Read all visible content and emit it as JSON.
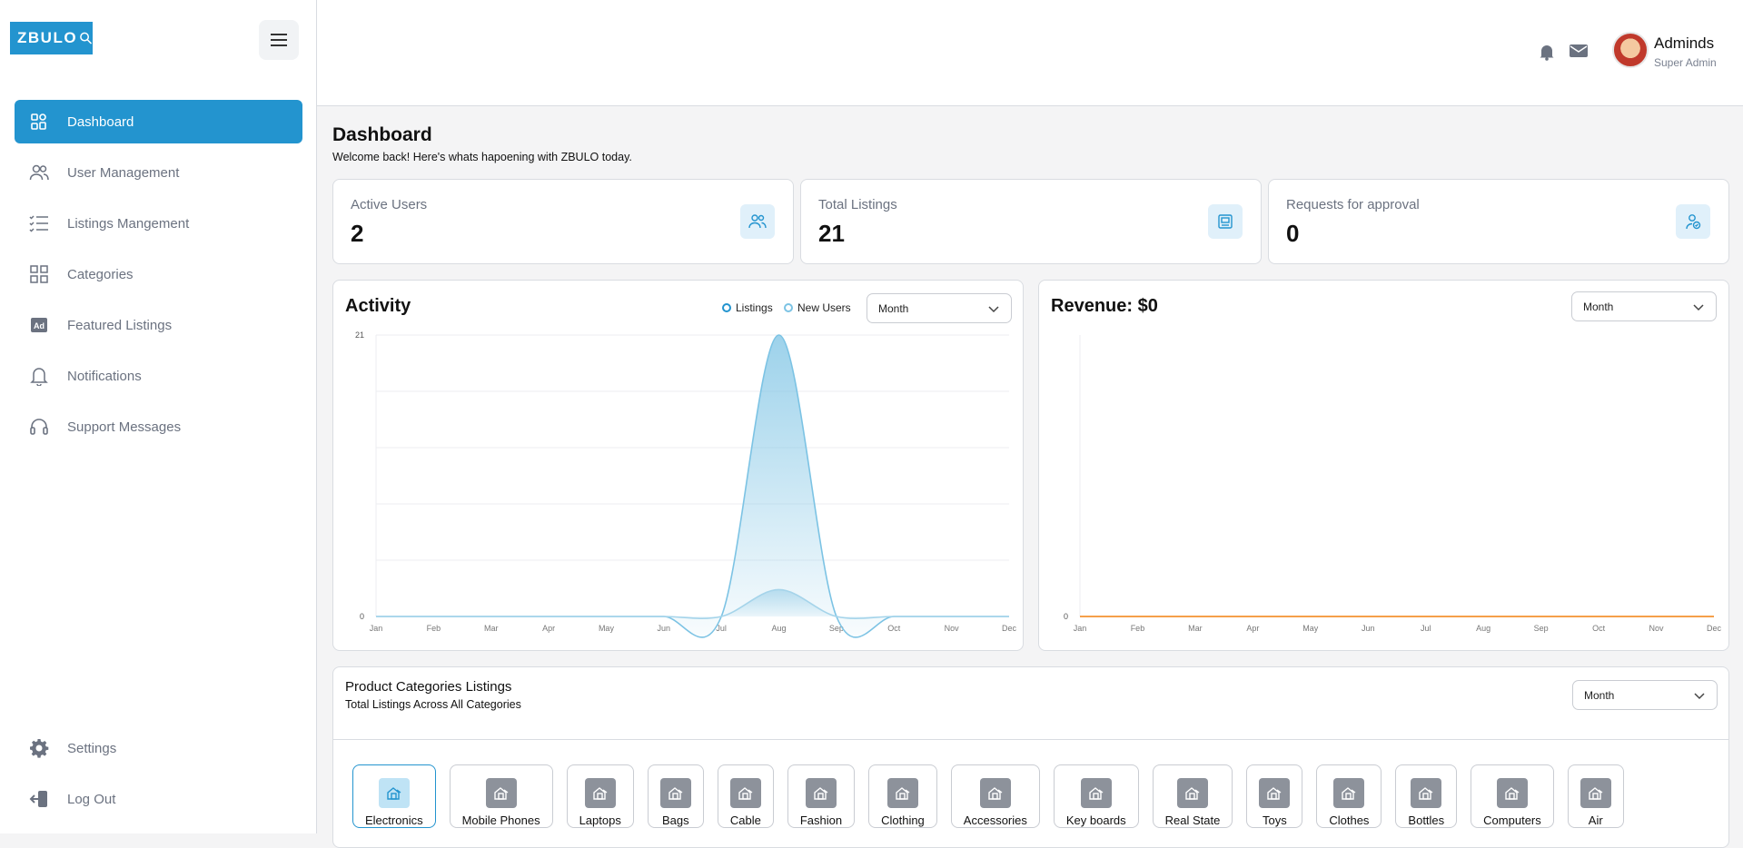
{
  "brand": {
    "logo_text": "ZBULO",
    "accent": "#2394cf"
  },
  "sidebar": {
    "items": [
      {
        "label": "Dashboard",
        "icon": "dashboard-icon",
        "active": true
      },
      {
        "label": "User Management",
        "icon": "users-icon"
      },
      {
        "label": "Listings Mangement",
        "icon": "list-check-icon"
      },
      {
        "label": "Categories",
        "icon": "grid-icon"
      },
      {
        "label": "Featured Listings",
        "icon": "ad-icon"
      },
      {
        "label": "Notifications",
        "icon": "bell-icon"
      },
      {
        "label": "Support Messages",
        "icon": "headset-icon"
      }
    ],
    "bottom": [
      {
        "label": "Settings",
        "icon": "gear-icon"
      },
      {
        "label": "Log Out",
        "icon": "logout-icon"
      }
    ]
  },
  "topbar": {
    "user_name": "Adminds",
    "user_role": "Super Admin"
  },
  "page": {
    "title": "Dashboard",
    "subtitle": "Welcome back! Here's whats hapoening with ZBULO today."
  },
  "stats": [
    {
      "label": "Active Users",
      "value": "2",
      "icon": "users-icon"
    },
    {
      "label": "Total Listings",
      "value": "21",
      "icon": "listing-icon"
    },
    {
      "label": "Requests for approval",
      "value": "0",
      "icon": "user-check-icon"
    }
  ],
  "activity": {
    "title": "Activity",
    "legend": [
      "Listings",
      "New Users"
    ],
    "period": "Month"
  },
  "revenue": {
    "title": "Revenue: $0",
    "period": "Month"
  },
  "categories_panel": {
    "title": "Product Categories Listings",
    "subtitle": "Total Listings Across All Categories",
    "period": "Month",
    "items": [
      "Electronics",
      "Mobile Phones",
      "Laptops",
      "Bags",
      "Cable",
      "Fashion",
      "Clothing",
      "Accessories",
      "Key boards",
      "Real State",
      "Toys",
      "Clothes",
      "Bottles",
      "Computers",
      "Air"
    ]
  },
  "chart_data": [
    {
      "type": "area",
      "title": "Activity",
      "categories": [
        "Jan",
        "Feb",
        "Mar",
        "Apr",
        "May",
        "Jun",
        "Jul",
        "Aug",
        "Sep",
        "Oct",
        "Nov",
        "Dec"
      ],
      "series": [
        {
          "name": "Listings",
          "values": [
            0,
            0,
            0,
            0,
            0,
            0,
            0,
            21,
            0,
            0,
            0,
            0
          ],
          "color": "#7cc3e4"
        },
        {
          "name": "New Users",
          "values": [
            0,
            0,
            0,
            0,
            0,
            0,
            0,
            2,
            0,
            0,
            0,
            0
          ],
          "color": "#a5d4ea"
        }
      ],
      "ylim": [
        0,
        21
      ],
      "yticks": [
        "0",
        "21"
      ],
      "grid": true
    },
    {
      "type": "line",
      "title": "Revenue: $0",
      "categories": [
        "Jan",
        "Feb",
        "Mar",
        "Apr",
        "May",
        "Jun",
        "Jul",
        "Aug",
        "Sep",
        "Oct",
        "Nov",
        "Dec"
      ],
      "series": [
        {
          "values": [
            0,
            0,
            0,
            0,
            0,
            0,
            0,
            0,
            0,
            0,
            0,
            0
          ],
          "color": "#f5a04a"
        }
      ],
      "yticks": [
        "0"
      ]
    }
  ]
}
